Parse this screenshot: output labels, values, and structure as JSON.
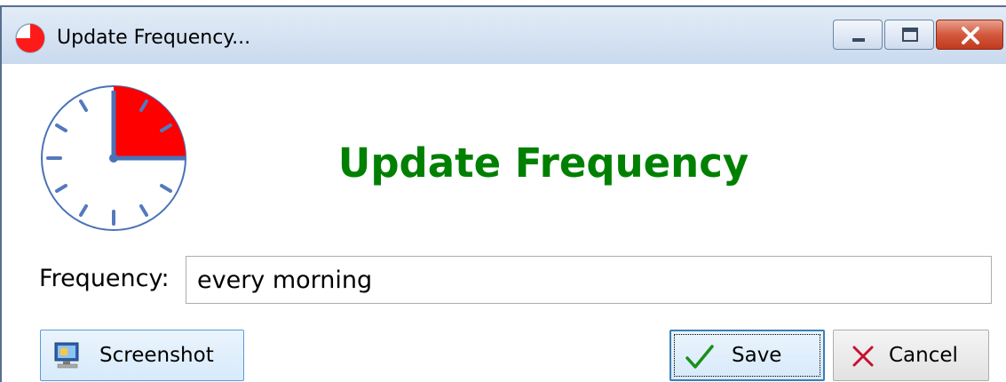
{
  "window": {
    "title": "Update Frequency...",
    "icon": "clock-pie-icon",
    "caption_buttons": [
      "minimize-icon",
      "restore-icon",
      "close-icon"
    ]
  },
  "header": {
    "title": "Update Frequency",
    "title_color": "#008000",
    "clock_icon": "clock-icon",
    "clock_highlight_color": "#ff0000"
  },
  "form": {
    "frequency_label": "Frequency:",
    "frequency_value": "every morning"
  },
  "buttons": {
    "screenshot_label": "Screenshot",
    "screenshot_icon": "monitor-icon",
    "save_label": "Save",
    "save_icon": "checkmark-icon",
    "cancel_label": "Cancel",
    "cancel_icon": "x-icon"
  }
}
